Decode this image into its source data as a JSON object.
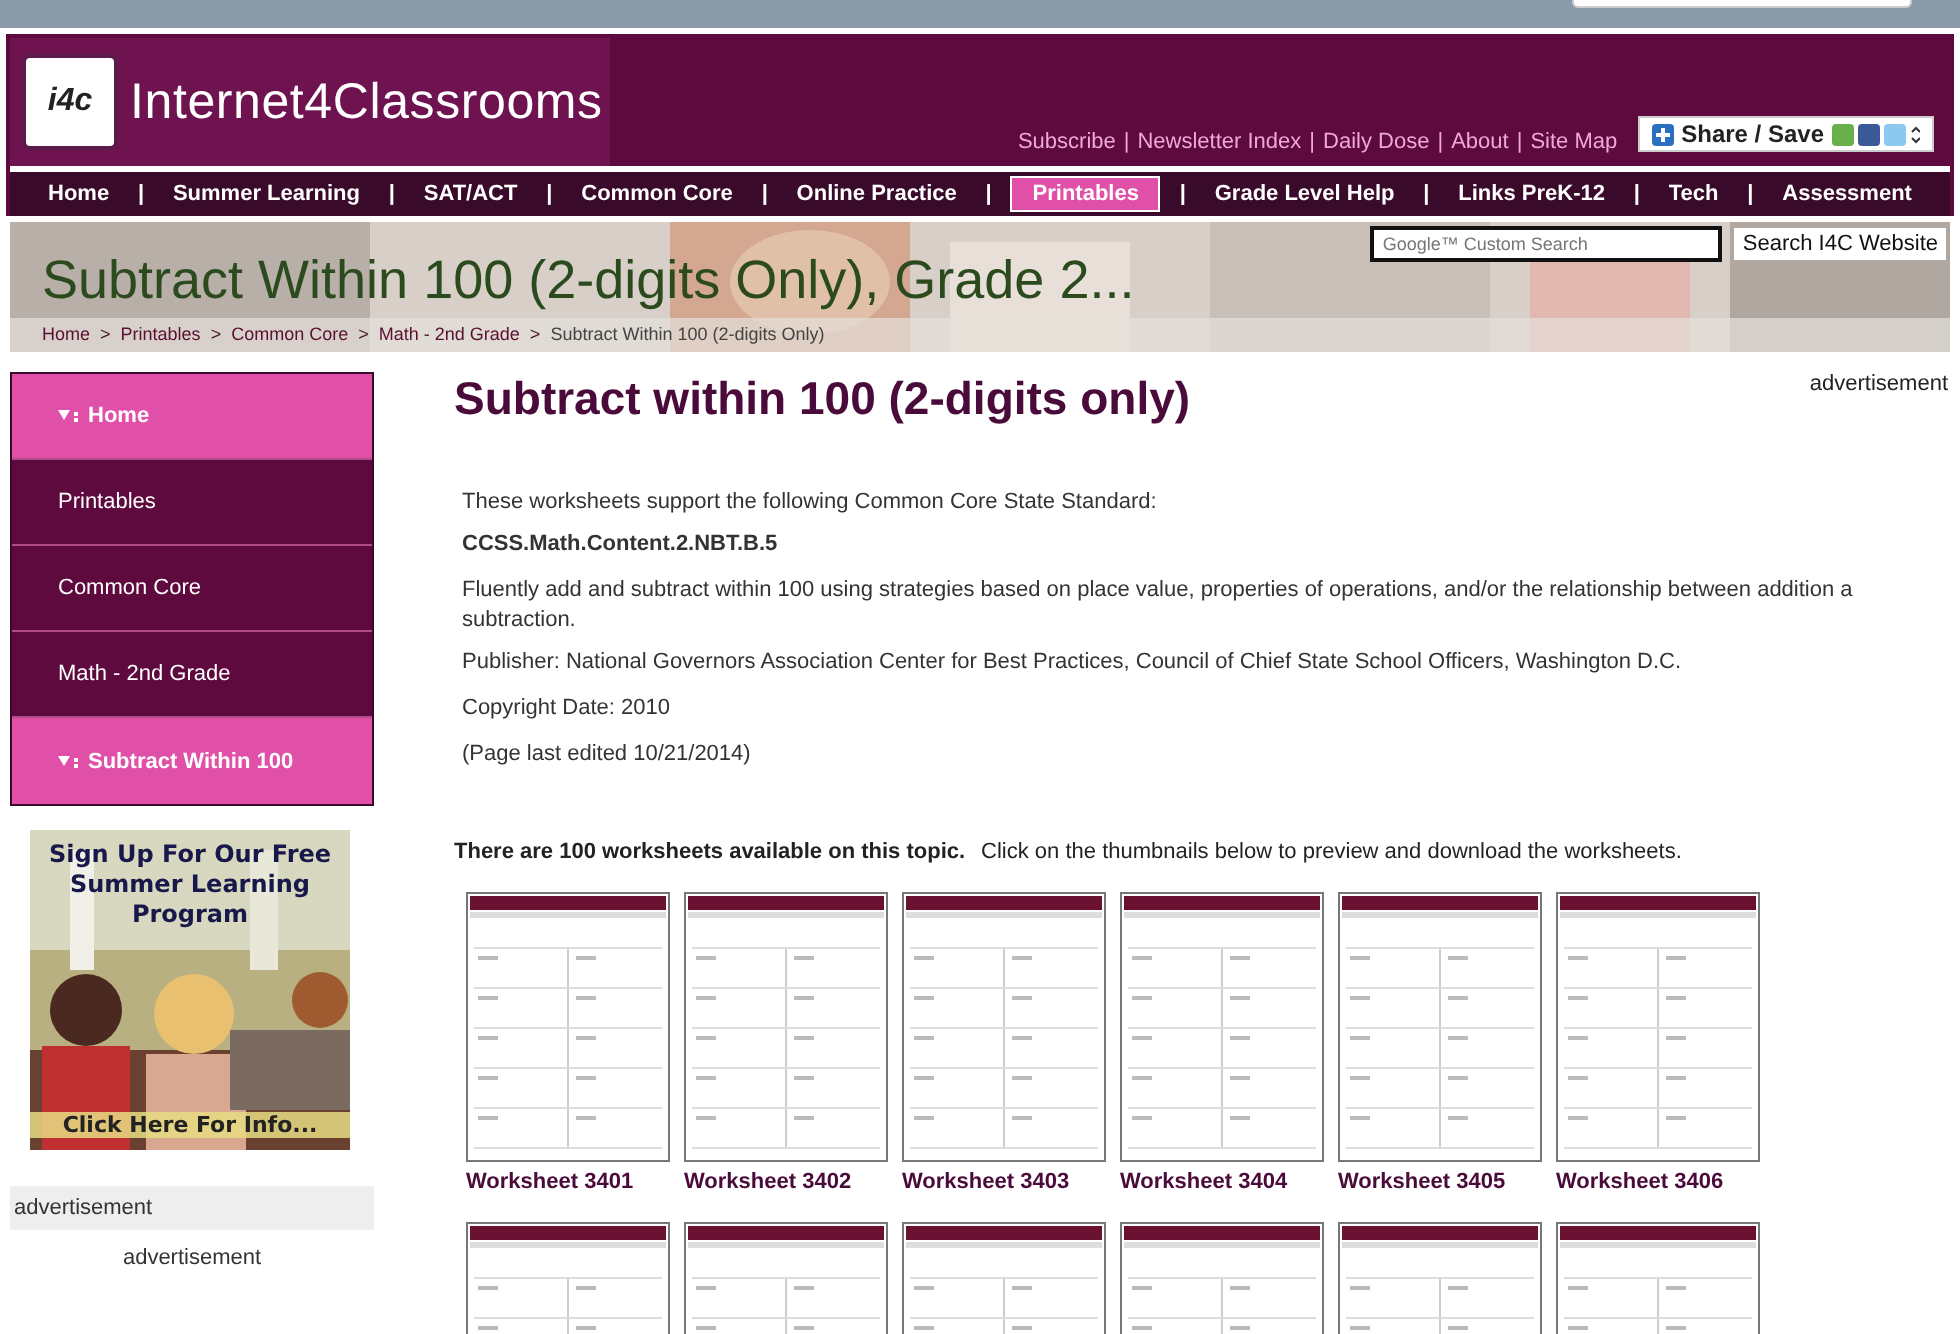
{
  "header": {
    "logo_badge": "i4c",
    "logo_text": "Internet4Classrooms",
    "separator": "|",
    "top_links": [
      "Subscribe",
      "Newsletter Index",
      "Daily Dose",
      "About",
      "Site Map"
    ],
    "share_button": "Share / Save"
  },
  "nav": {
    "separator": "|",
    "items": [
      {
        "label": "Home",
        "selected": false
      },
      {
        "label": "Summer Learning",
        "selected": false
      },
      {
        "label": "SAT/ACT",
        "selected": false
      },
      {
        "label": "Common Core",
        "selected": false
      },
      {
        "label": "Online Practice",
        "selected": false
      },
      {
        "label": "Printables",
        "selected": true
      },
      {
        "label": "Grade Level Help",
        "selected": false
      },
      {
        "label": "Links PreK-12",
        "selected": false
      },
      {
        "label": "Tech",
        "selected": false
      },
      {
        "label": "Assessment",
        "selected": false
      }
    ]
  },
  "banner": {
    "title": "Subtract Within 100 (2-digits Only), Grade 2...",
    "search_placeholder": "Google™ Custom Search",
    "search_button": "Search I4C Website",
    "breadcrumb_separator": ">",
    "breadcrumb": [
      "Home",
      "Printables",
      "Common Core",
      "Math - 2nd Grade",
      "Subtract Within 100 (2-digits Only)"
    ]
  },
  "sidebar": {
    "items": [
      {
        "label": "Home",
        "selected": true
      },
      {
        "label": "Printables",
        "selected": false
      },
      {
        "label": "Common Core",
        "selected": false
      },
      {
        "label": "Math - 2nd Grade",
        "selected": false
      },
      {
        "label": "Subtract Within 100",
        "selected": true
      }
    ],
    "ad": {
      "headline": "Sign Up For Our Free Summer Learning Program",
      "footer": "Click Here For Info..."
    },
    "ad_label": "advertisement",
    "ad_label_2": "advertisement"
  },
  "main": {
    "title": "Subtract within 100 (2-digits only)",
    "ad_label": "advertisement",
    "intro": "These worksheets support the following Common Core State Standard:",
    "standard": "CCSS.Math.Content.2.NBT.B.5",
    "description_lines": [
      "Fluently add and subtract within 100 using strategies based on place value, properties of operations, and/or the relationship between addition a",
      "subtraction."
    ],
    "publisher": "Publisher: National Governors Association Center for Best Practices, Council of Chief State School Officers, Washington D.C.",
    "copyright": "Copyright Date: 2010",
    "edited": "(Page last edited 10/21/2014)",
    "count_text": "There are 100 worksheets available on this topic.",
    "count_hint": "Click on the thumbnails below to preview and download the worksheets.",
    "worksheets": [
      {
        "kind": "worksheet",
        "label": "Worksheet 3401"
      },
      {
        "kind": "worksheet",
        "label": "Worksheet 3402"
      },
      {
        "kind": "worksheet",
        "label": "Worksheet 3403"
      },
      {
        "kind": "worksheet",
        "label": "Worksheet 3404"
      },
      {
        "kind": "worksheet",
        "label": "Worksheet 3405"
      },
      {
        "kind": "worksheet",
        "label": "Worksheet 3406"
      },
      {
        "kind": "worksheet"
      },
      {
        "kind": "worksheet"
      },
      {
        "kind": "worksheet"
      },
      {
        "kind": "worksheet"
      },
      {
        "kind": "worksheet"
      },
      {
        "kind": "worksheet"
      }
    ]
  }
}
